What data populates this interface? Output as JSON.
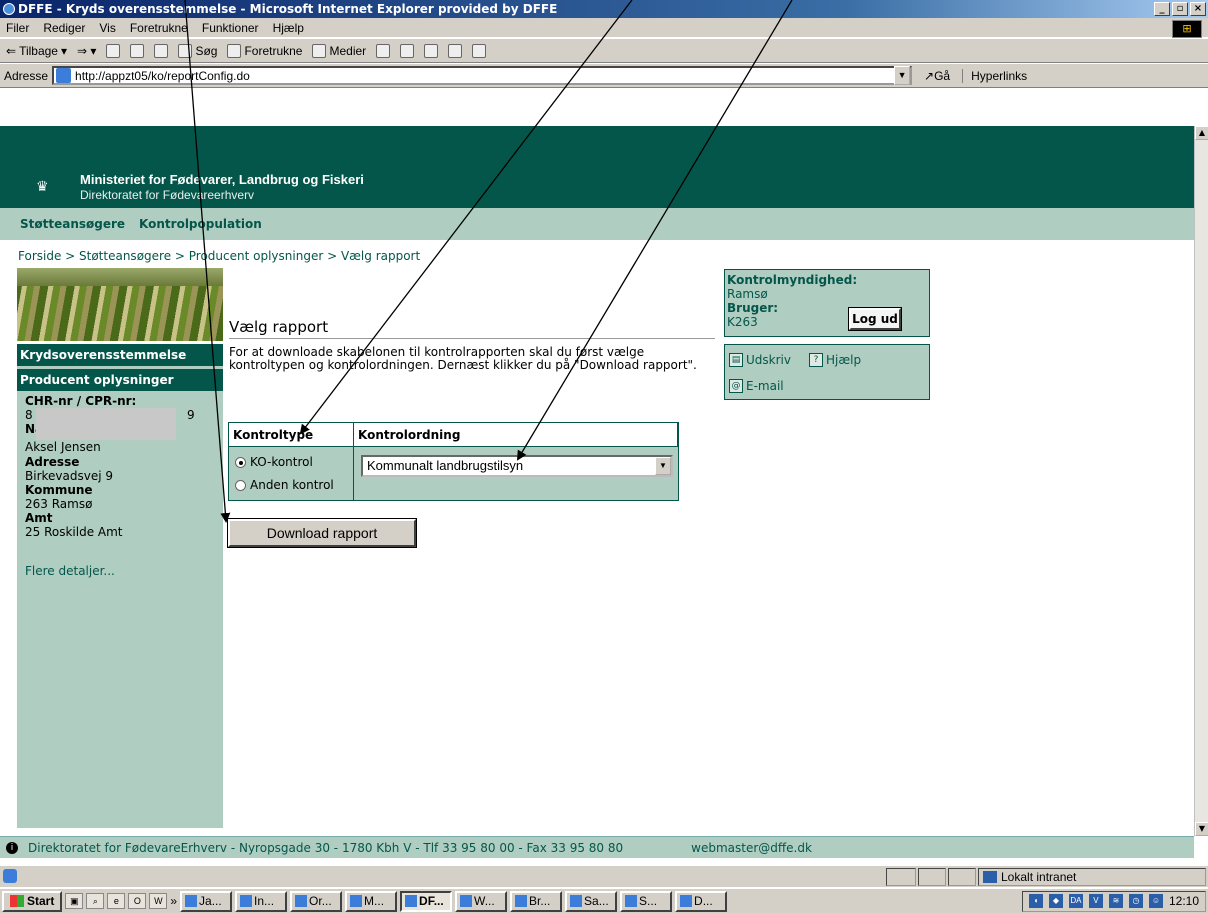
{
  "window": {
    "title": "DFFE - Kryds overensstemmelse - Microsoft Internet Explorer provided by DFFE"
  },
  "menu": [
    "Filer",
    "Rediger",
    "Vis",
    "Foretrukne",
    "Funktioner",
    "Hjælp"
  ],
  "toolbar": {
    "back": "Tilbage",
    "search": "Søg",
    "favorites": "Foretrukne",
    "media": "Medier"
  },
  "address": {
    "label": "Adresse",
    "url": "http://appzt05/ko/reportConfig.do",
    "go": "Gå",
    "links": "Hyperlinks"
  },
  "header": {
    "ministry": "Ministeriet for Fødevarer, Landbrug og Fiskeri",
    "directorate": "Direktoratet for Fødevareerhverv"
  },
  "nav": [
    "Støtteansøgere",
    "Kontrolpopulation"
  ],
  "breadcrumb": "Forside > Støtteansøgere > Producent oplysninger > Vælg rapport",
  "left": {
    "heading1": "Krydsoverensstemmelse",
    "heading2": "Producent oplysninger",
    "cvr_label": "CHR-nr / CPR-nr:",
    "cvr_value_frag1": "8",
    "cvr_value_frag2": "9",
    "name_label": "Navn",
    "name": "Aksel Jensen",
    "address_label": "Adresse",
    "address": "Birkevadsvej 9",
    "kommune_label": "Kommune",
    "kommune": "263 Ramsø",
    "amt_label": "Amt",
    "amt": "25 Roskilde Amt",
    "more": "Flere detaljer..."
  },
  "main": {
    "title": "Vælg rapport",
    "intro": "For at downloade skabelonen til kontrolrapporten skal du først vælge kontroltypen og kontrolordningen. Dernæst klikker du på \"Download rapport\".",
    "col_type": "Kontroltype",
    "col_scheme": "Kontrolordning",
    "radio1": "KO-kontrol",
    "radio2": "Anden kontrol",
    "select_value": "Kommunalt landbrugstilsyn",
    "download": "Download rapport"
  },
  "authority": {
    "label": "Kontrolmyndighed:",
    "value": "Ramsø",
    "user_label": "Bruger:",
    "user": "K263",
    "logout": "Log ud"
  },
  "utilities": {
    "print": "Udskriv",
    "help": "Hjælp",
    "email": "E-mail"
  },
  "footer": {
    "text": "Direktoratet for FødevareErhverv - Nyropsgade 30 - 1780 Kbh V - Tlf 33 95 80 00 - Fax 33 95 80 80",
    "email": "webmaster@dffe.dk"
  },
  "status": {
    "zone": "Lokalt intranet"
  },
  "taskbar": {
    "start": "Start",
    "tasks": [
      "Ja...",
      "In...",
      "Or...",
      "M...",
      "DF...",
      "W...",
      "Br...",
      "Sa...",
      "S...",
      "D..."
    ],
    "clock": "12:10"
  }
}
